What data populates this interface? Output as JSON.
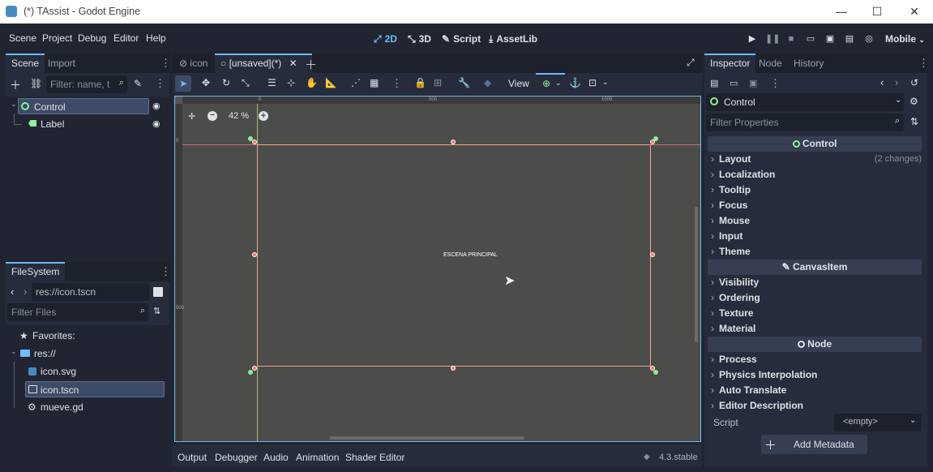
{
  "window": {
    "title": "(*) TAssist - Godot Engine",
    "minimize": "—",
    "maximize": "☐",
    "close": "✕"
  },
  "menu": {
    "items": [
      "Scene",
      "Project",
      "Debug",
      "Editor",
      "Help"
    ]
  },
  "workspaces": {
    "btn_2d": "2D",
    "btn_3d": "3D",
    "btn_script": "Script",
    "btn_assetlib": "AssetLib"
  },
  "renderer": "Mobile",
  "scene_dock": {
    "tabs": [
      "Scene",
      "Import"
    ],
    "filter_placeholder": "Filter: name, t:typ",
    "nodes": [
      {
        "label": "Control"
      },
      {
        "label": "Label"
      }
    ]
  },
  "filesystem_dock": {
    "tab": "FileSystem",
    "path": "res://icon.tscn",
    "filter_placeholder": "Filter Files",
    "items": [
      {
        "label": "Favorites:"
      },
      {
        "label": "res://"
      },
      {
        "label": "icon.svg"
      },
      {
        "label": "icon.tscn"
      },
      {
        "label": "mueve.gd"
      }
    ]
  },
  "editor_tabs": {
    "tab1": "icon",
    "tab2": "[unsaved](*)"
  },
  "toolbar": {
    "view": "View"
  },
  "canvas": {
    "zoom": "42 %",
    "label_text": "ESCENA PRINCIPAL",
    "ruler_h": [
      "0",
      "500",
      "1000"
    ],
    "ruler_v": [
      "0",
      "500"
    ]
  },
  "bottom_panel": {
    "items": [
      "Output",
      "Debugger",
      "Audio",
      "Animation",
      "Shader Editor"
    ],
    "version": "4.3.stable"
  },
  "inspector": {
    "tabs": [
      "Inspector",
      "Node",
      "History"
    ],
    "object_name": "Control",
    "filter_placeholder": "Filter Properties",
    "sections": {
      "control": "Control",
      "canvasitem": "CanvasItem",
      "node": "Node"
    },
    "control_props": [
      "Layout",
      "Localization",
      "Tooltip",
      "Focus",
      "Mouse",
      "Input",
      "Theme"
    ],
    "layout_changes": "(2 changes)",
    "canvasitem_props": [
      "Visibility",
      "Ordering",
      "Texture",
      "Material"
    ],
    "node_props": [
      "Process",
      "Physics Interpolation",
      "Auto Translate",
      "Editor Description"
    ],
    "script_label": "Script",
    "script_value": "<empty>",
    "add_metadata": "Add Metadata"
  },
  "colors": {
    "accent": "#70bafa",
    "control_icon": "#8eef97",
    "selection": "#3e4b66",
    "canvas_bg": "#4c4c4b",
    "control_rect": "#f3a585"
  }
}
